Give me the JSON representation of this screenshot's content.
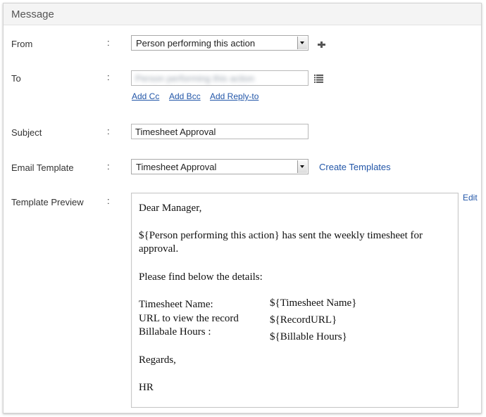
{
  "panel": {
    "title": "Message"
  },
  "fields": {
    "from": {
      "label": "From",
      "value": "Person performing this action"
    },
    "to": {
      "label": "To",
      "value": "Person performing this action",
      "links": {
        "cc": "Add Cc",
        "bcc": "Add Bcc",
        "reply_to": "Add Reply-to"
      }
    },
    "subject": {
      "label": "Subject",
      "value": "Timesheet Approval"
    },
    "email_template": {
      "label": "Email Template",
      "value": "Timesheet Approval",
      "create_link": "Create Templates"
    },
    "template_preview": {
      "label": "Template Preview",
      "edit": "Edit"
    }
  },
  "colon": ":",
  "preview": {
    "greeting": "Dear Manager,",
    "body_line1": "${Person performing this action} has sent the weekly timesheet for",
    "body_line2": "approval.",
    "details_intro": "Please find below the details:",
    "rows": [
      {
        "label": "Timesheet Name:",
        "value": "${Timesheet Name}"
      },
      {
        "label": "URL to view the record",
        "value": "${RecordURL}"
      },
      {
        "label": "Billabale Hours :",
        "value": "${Billable Hours}"
      }
    ],
    "regards": "Regards,",
    "signature": "HR"
  },
  "icons": {
    "add": "plus-icon",
    "contacts": "list-icon"
  }
}
